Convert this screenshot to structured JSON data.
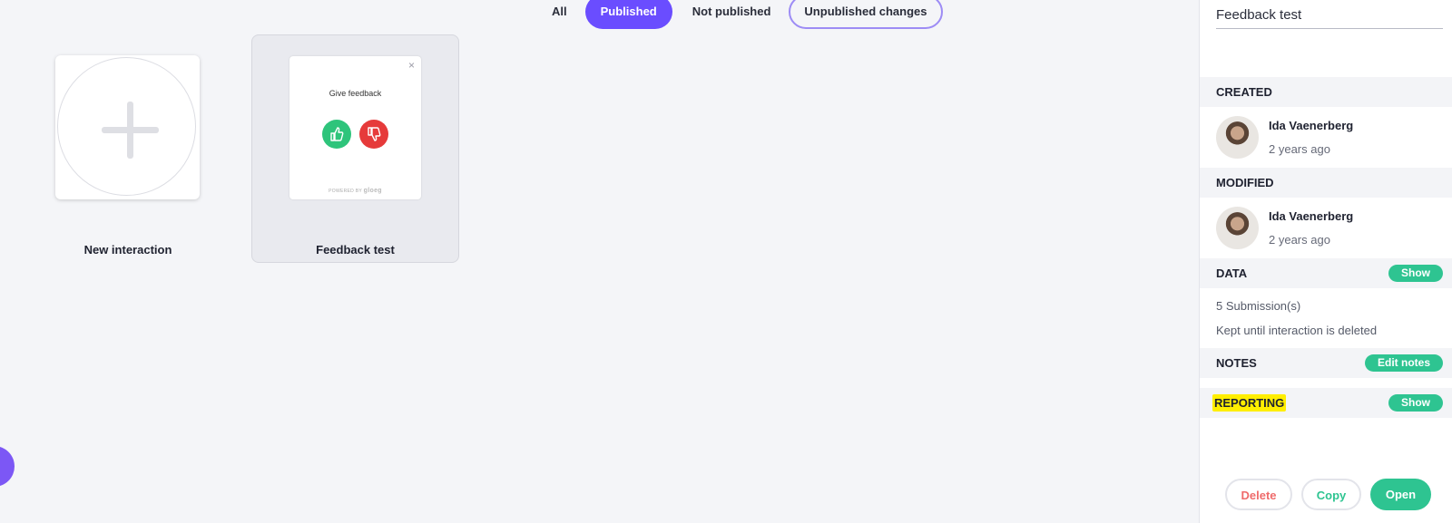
{
  "filters": [
    {
      "label": "All"
    },
    {
      "label": "Published",
      "active": true
    },
    {
      "label": "Not published"
    },
    {
      "label": "Unpublished changes"
    }
  ],
  "cards": {
    "new": {
      "label": "New interaction"
    },
    "feedback": {
      "label": "Feedback test",
      "preview_title": "Give feedback",
      "powered_by": "POWERED BY",
      "brand": "gloeg",
      "close_glyph": "×"
    }
  },
  "panel": {
    "title_value": "Feedback test",
    "created": {
      "header": "CREATED",
      "name": "Ida Vaenerberg",
      "time": "2 years ago"
    },
    "modified": {
      "header": "MODIFIED",
      "name": "Ida Vaenerberg",
      "time": "2 years ago"
    },
    "data": {
      "header": "DATA",
      "button": "Show",
      "submissions": "5 Submission(s)",
      "retention": "Kept until interaction is deleted"
    },
    "notes": {
      "header": "NOTES",
      "button": "Edit notes"
    },
    "reporting": {
      "header": "REPORTING",
      "button": "Show"
    },
    "actions": {
      "delete": "Delete",
      "copy": "Copy",
      "open": "Open"
    }
  },
  "colors": {
    "accent": "#6a4dff",
    "green": "#2ec491",
    "red": "#e63a3a",
    "highlight": "#ffee00"
  }
}
